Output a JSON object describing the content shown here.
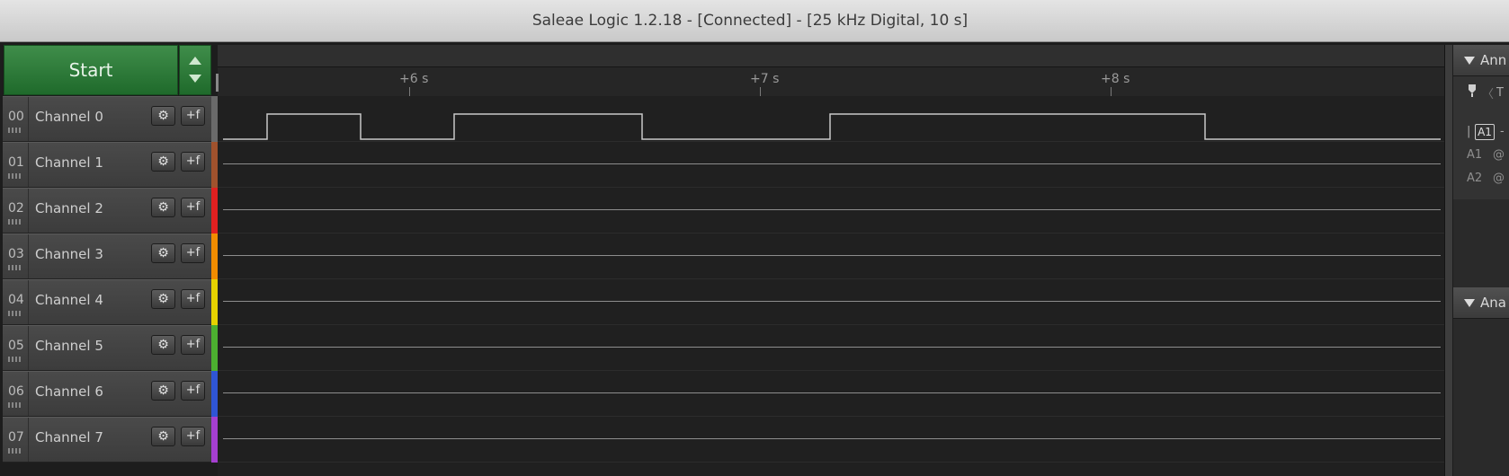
{
  "window": {
    "title": "Saleae Logic 1.2.18 - [Connected] - [25 kHz Digital, 10 s]"
  },
  "start_button": {
    "label": "Start"
  },
  "timeline": {
    "ticks": [
      "+6 s",
      "+7 s",
      "+8 s"
    ]
  },
  "channels": [
    {
      "index": "00",
      "name": "Channel 0",
      "color": "#6a6a6a"
    },
    {
      "index": "01",
      "name": "Channel 1",
      "color": "#a0522d"
    },
    {
      "index": "02",
      "name": "Channel 2",
      "color": "#e02020"
    },
    {
      "index": "03",
      "name": "Channel 3",
      "color": "#f08c00"
    },
    {
      "index": "04",
      "name": "Channel 4",
      "color": "#e6d200"
    },
    {
      "index": "05",
      "name": "Channel 5",
      "color": "#4caf30"
    },
    {
      "index": "06",
      "name": "Channel 6",
      "color": "#2f55d4"
    },
    {
      "index": "07",
      "name": "Channel 7",
      "color": "#a53fd0"
    }
  ],
  "channel_buttons": {
    "gear_icon": "gear-icon",
    "trigger_icon": "trigger-edge-icon",
    "trigger_glyph": "+f"
  },
  "right_panel": {
    "annotations_header": "Ann",
    "analyzers_header": "Ana",
    "timing_marker_label": "T",
    "badge": "A1",
    "pin_icon": "pin-icon",
    "rows": [
      {
        "name": "A1",
        "at": "@"
      },
      {
        "name": "A2",
        "at": "@"
      }
    ],
    "dash": "-"
  }
}
